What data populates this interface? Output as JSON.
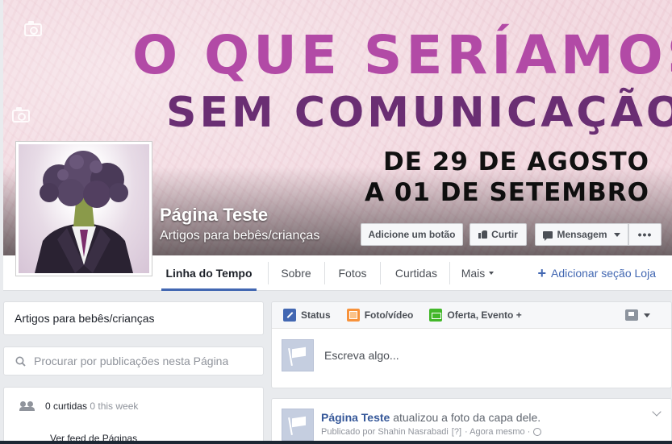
{
  "cover": {
    "line1": "O QUE SERÍAMOS",
    "line2": "SEM COMUNICAÇÃO?",
    "line3": "DE 29 DE AGOSTO",
    "line4": "A 01 DE SETEMBRO"
  },
  "page": {
    "name": "Página Teste",
    "category": "Artigos para bebês/crianças"
  },
  "actions": {
    "add_button": "Adicione um botão",
    "like": "Curtir",
    "message": "Mensagem",
    "more": "•••"
  },
  "nav": {
    "tabs": [
      "Linha do Tempo",
      "Sobre",
      "Fotos",
      "Curtidas",
      "Mais"
    ],
    "add_shop": "Adicionar seção Loja"
  },
  "left": {
    "category": "Artigos para bebês/crianças",
    "search_placeholder": "Procurar por publicações nesta Página",
    "likes_count": "0 curtidas",
    "likes_week": "0 this week",
    "feed_link": "Ver feed de Páginas"
  },
  "composer": {
    "status": "Status",
    "photo": "Foto/vídeo",
    "offer": "Oferta, Evento +",
    "placeholder": "Escreva algo..."
  },
  "post": {
    "author": "Página Teste",
    "action": "atualizou a foto da capa dele.",
    "meta": "Publicado por Shahin Nasrabadi",
    "help": "[?]",
    "time": "· Agora mesmo ·"
  }
}
